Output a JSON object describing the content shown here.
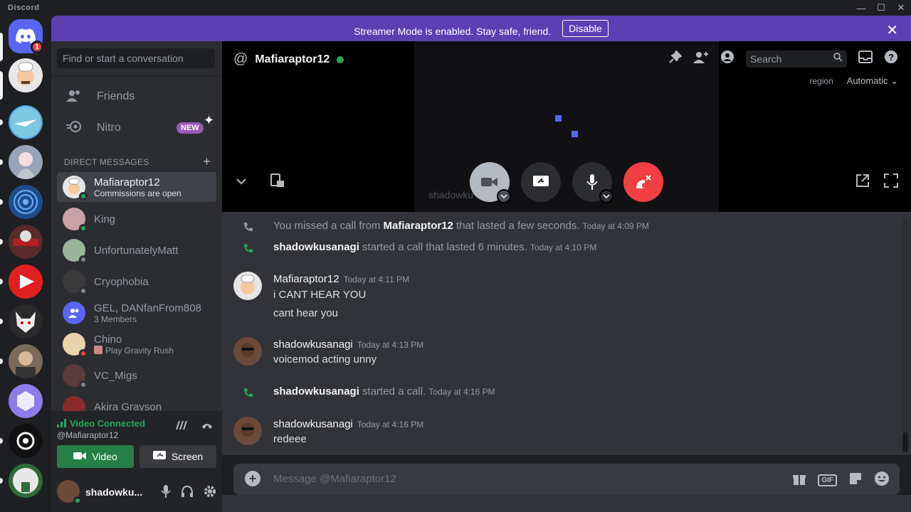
{
  "app": {
    "title": "Discord"
  },
  "window": {
    "minimize": "—",
    "maximize": "☐",
    "close": "✕"
  },
  "banner": {
    "message": "Streamer Mode is enabled. Stay safe, friend.",
    "button": "Disable",
    "close": "✕"
  },
  "guilds": {
    "home_badge": "1",
    "items": [
      {
        "name": "discord-home",
        "color": "#5865f2"
      },
      {
        "name": "pizza-chef",
        "color": "#e8e8e8"
      },
      {
        "name": "airline",
        "color": "#4aa3df"
      },
      {
        "name": "anime-girl",
        "color": "#9aa4b8"
      },
      {
        "name": "blue-rings",
        "color": "#1e4d8c"
      },
      {
        "name": "warriors",
        "color": "#5a2a2a"
      },
      {
        "name": "red-play",
        "color": "#e02020"
      },
      {
        "name": "wolf",
        "color": "#2a2a2a"
      },
      {
        "name": "man-portrait",
        "color": "#7a6a5a"
      },
      {
        "name": "purple-cube",
        "color": "#8e7de8"
      },
      {
        "name": "openai",
        "color": "#111111"
      },
      {
        "name": "ltm",
        "color": "#2e6b3a"
      }
    ]
  },
  "sidebar": {
    "search_placeholder": "Find or start a conversation",
    "friends_label": "Friends",
    "nitro_label": "Nitro",
    "nitro_badge": "NEW",
    "dm_header": "DIRECT MESSAGES",
    "dm_add": "+",
    "dms": [
      {
        "name": "Mafiaraptor12",
        "sub": "Commissions are open",
        "status": "#23a55a",
        "avatar": "#e6e6e6"
      },
      {
        "name": "King",
        "sub": "",
        "status": "#23a55a",
        "avatar": "#c8a2a8"
      },
      {
        "name": "UnfortunatelyMatt",
        "sub": "",
        "status": "#80848e",
        "avatar": "#9bb59b"
      },
      {
        "name": "Cryophobia",
        "sub": "",
        "status": "#80848e",
        "avatar": "#3a3a3a"
      },
      {
        "name": "GEL, DANfanFrom808",
        "sub": "3 Members",
        "status": "",
        "avatar": "#5865f2"
      },
      {
        "name": "Chino",
        "sub": "Play Gravity Rush",
        "status": "#f23f43",
        "avatar": "#e8d4a8"
      },
      {
        "name": "VC_Migs",
        "sub": "",
        "status": "#80848e",
        "avatar": "#5a3a3a"
      },
      {
        "name": "Akira Grayson",
        "sub": "",
        "status": "",
        "avatar": "#8a2a2a"
      }
    ]
  },
  "voice": {
    "status": "Video Connected",
    "channel": "@Mafiaraptor12",
    "video_button": "Video",
    "screen_button": "Screen"
  },
  "user": {
    "name": "shadowku..."
  },
  "call": {
    "at": "@",
    "title": "Mafiaraptor12",
    "search_placeholder": "Search",
    "region_label": "region",
    "region_value": "Automatic",
    "overlay_name": "shadowku"
  },
  "messages": {
    "sys1": {
      "text": "You missed a call from ",
      "name": "Mafiaraptor12",
      "rest": " that lasted a few seconds.",
      "ts": "Today at 4:09 PM"
    },
    "sys2": {
      "name": "shadowkusanagi",
      "rest": " started a call that lasted 6 minutes.",
      "ts": "Today at 4:10 PM"
    },
    "m1": {
      "name": "Mafiaraptor12",
      "ts": "Today at 4:11 PM",
      "lines": [
        "i CANT HEAR YOU",
        "cant hear you"
      ]
    },
    "m2": {
      "name": "shadowkusanagi",
      "ts": "Today at 4:13 PM",
      "lines": [
        "voicemod acting unny"
      ]
    },
    "sys3": {
      "name": "shadowkusanagi",
      "rest": " started a call.",
      "ts": "Today at 4:16 PM"
    },
    "m3": {
      "name": "shadowkusanagi",
      "ts": "Today at 4:16 PM",
      "lines": [
        "redeee"
      ]
    }
  },
  "composer": {
    "placeholder": "Message @Mafiaraptor12",
    "gif": "GIF"
  }
}
